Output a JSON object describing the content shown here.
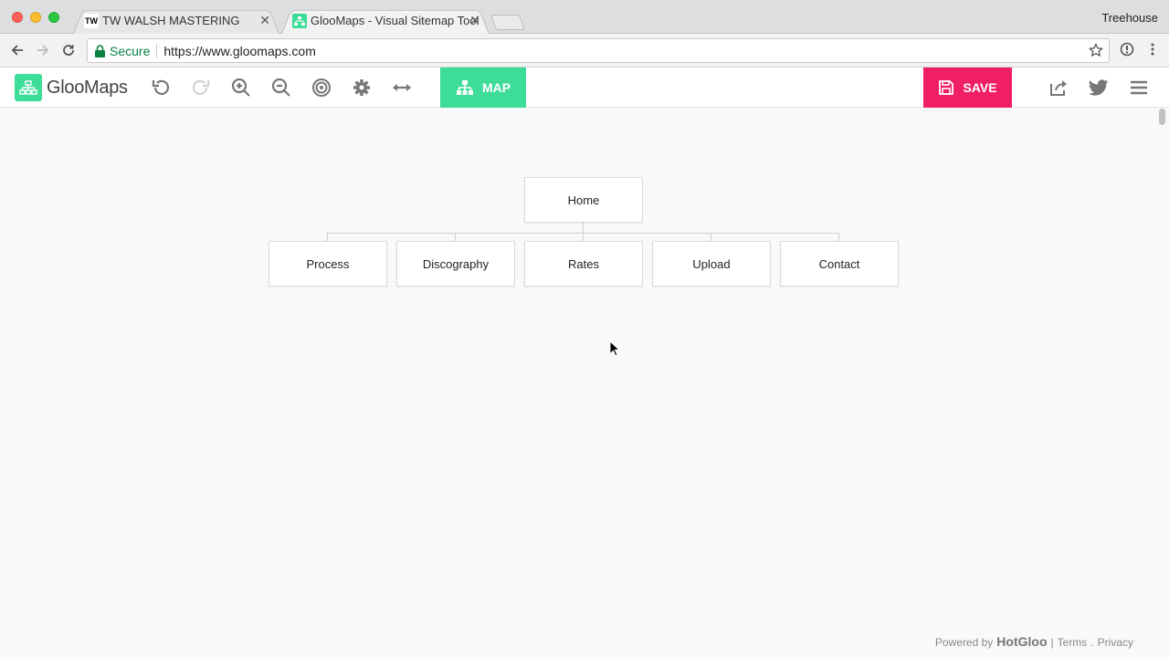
{
  "browser": {
    "tabs": [
      {
        "favicon": "TW",
        "title": "TW WALSH MASTERING",
        "active": false
      },
      {
        "favicon": "gloomaps-icon",
        "title": "GlooMaps - Visual Sitemap Tool",
        "active": true
      }
    ],
    "profile": "Treehouse",
    "address": {
      "secure_label": "Secure",
      "url": "https://www.gloomaps.com"
    }
  },
  "app": {
    "logo_text": "GlooMaps",
    "toolbar": {
      "tools": [
        "undo-icon",
        "redo-icon",
        "zoom-in-icon",
        "zoom-out-icon",
        "target-icon",
        "gear-icon",
        "expand-horizontal-icon"
      ],
      "map_label": "MAP",
      "save_label": "SAVE",
      "right_tools": [
        "share-icon",
        "twitter-icon",
        "menu-icon"
      ]
    },
    "colors": {
      "accent": "#3ddc97",
      "save": "#ef1e67"
    }
  },
  "sitemap": {
    "root": "Home",
    "children": [
      "Process",
      "Discography",
      "Rates",
      "Upload",
      "Contact"
    ]
  },
  "footer": {
    "powered_by": "Powered by",
    "brand": "HotGloo",
    "separator": "|",
    "terms": "Terms",
    "dot": ".",
    "privacy": "Privacy"
  }
}
